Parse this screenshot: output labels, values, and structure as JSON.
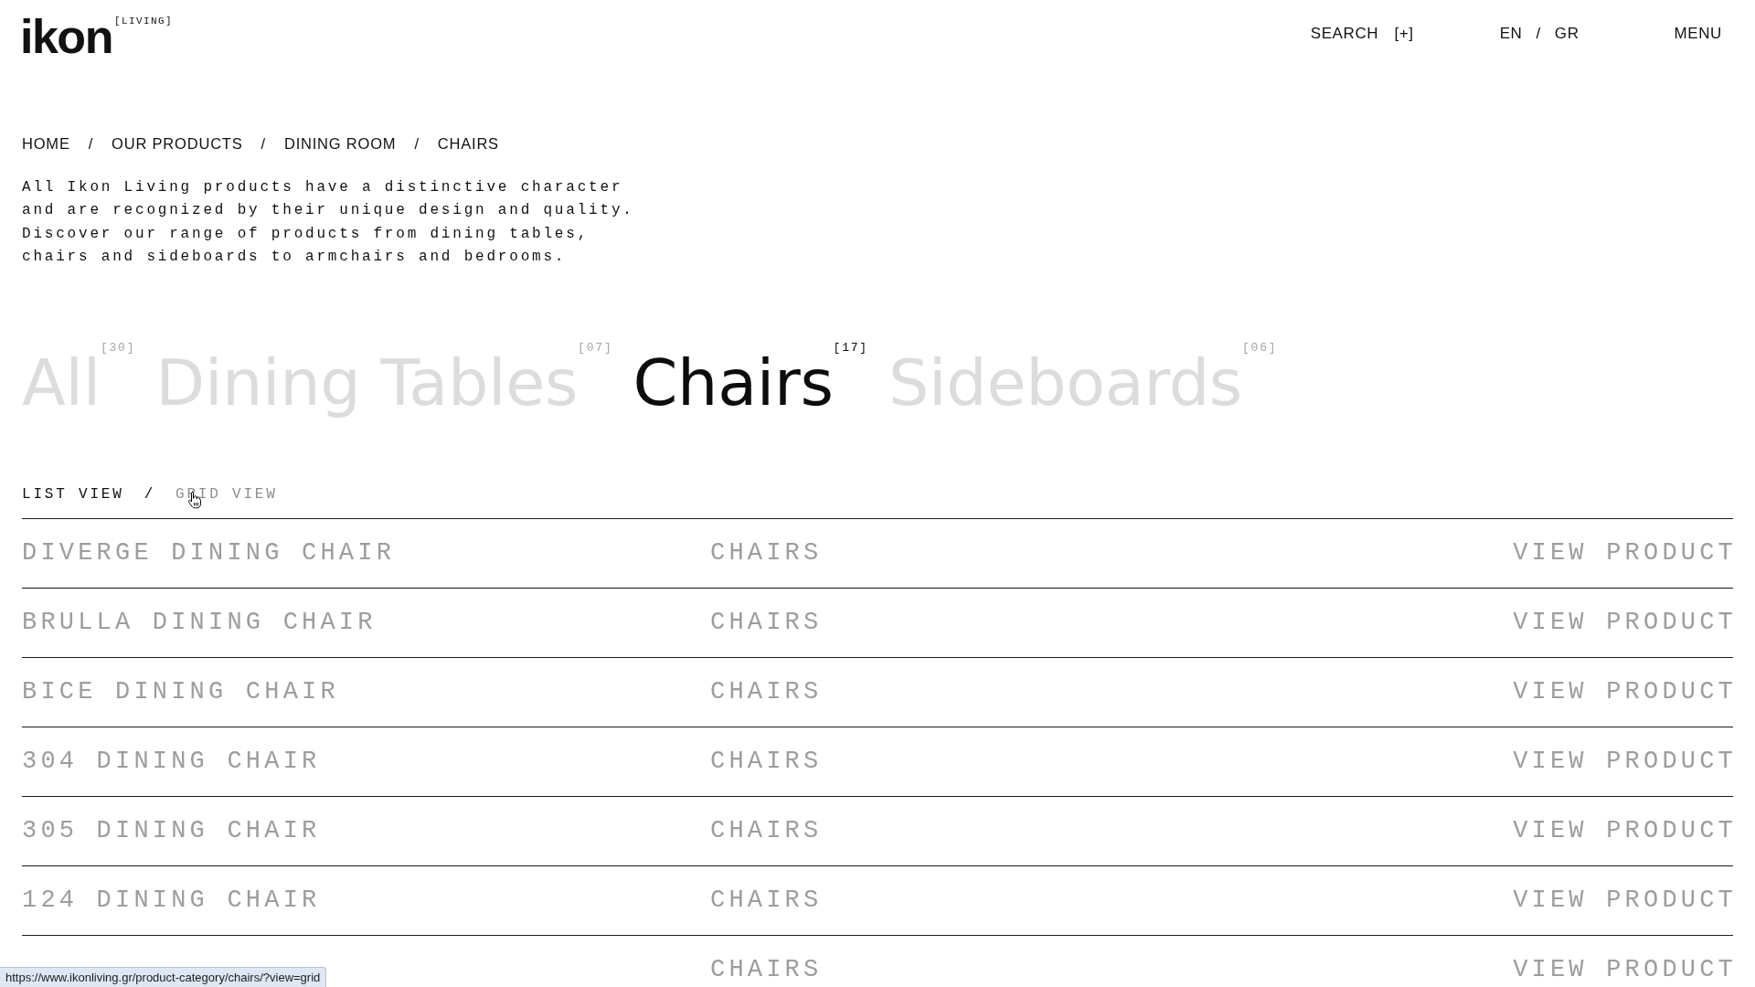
{
  "header": {
    "logo": {
      "wordmark": "ikon",
      "tag": "[LIVING]"
    },
    "search": "SEARCH [+]",
    "languages": {
      "options": [
        {
          "label": "EN"
        },
        {
          "label": "GR"
        }
      ],
      "separator": "/"
    },
    "menu": "MENU"
  },
  "breadcrumb": {
    "items": [
      "HOME",
      "OUR PRODUCTS",
      "DINING ROOM",
      "CHAIRS"
    ],
    "separators": [
      "/",
      "/",
      "/"
    ]
  },
  "description": "All Ikon Living products have a distinctive character and are recognized by their unique design and quality. Discover our range of products from dining tables, chairs and sideboards to armchairs and bedrooms.",
  "categories": [
    {
      "label": "All",
      "count": "[30]",
      "selected": false
    },
    {
      "label": "Dining Tables",
      "count": "[07]",
      "selected": false
    },
    {
      "label": "Chairs",
      "count": "[17]",
      "selected": true
    },
    {
      "label": "Sideboards",
      "count": "[06]",
      "selected": false
    }
  ],
  "view_toggle": {
    "options": [
      {
        "label": "LIST VIEW",
        "selected": true
      },
      {
        "label": "GRID VIEW",
        "selected": false
      }
    ],
    "separator": "/"
  },
  "products": [
    {
      "name": "DIVERGE DINING CHAIR",
      "category": "CHAIRS",
      "action": "VIEW PRODUCT"
    },
    {
      "name": "BRULLA DINING CHAIR",
      "category": "CHAIRS",
      "action": "VIEW PRODUCT"
    },
    {
      "name": "BICE DINING CHAIR",
      "category": "CHAIRS",
      "action": "VIEW PRODUCT"
    },
    {
      "name": "304 DINING CHAIR",
      "category": "CHAIRS",
      "action": "VIEW PRODUCT"
    },
    {
      "name": "305 DINING CHAIR",
      "category": "CHAIRS",
      "action": "VIEW PRODUCT"
    },
    {
      "name": "124 DINING CHAIR",
      "category": "CHAIRS",
      "action": "VIEW PRODUCT"
    },
    {
      "category": "CHAIRS",
      "action": "VIEW PRODUCT"
    }
  ],
  "browser_status": {
    "url": "https://www.ikonliving.gr/product-category/chairs/?view=grid"
  }
}
